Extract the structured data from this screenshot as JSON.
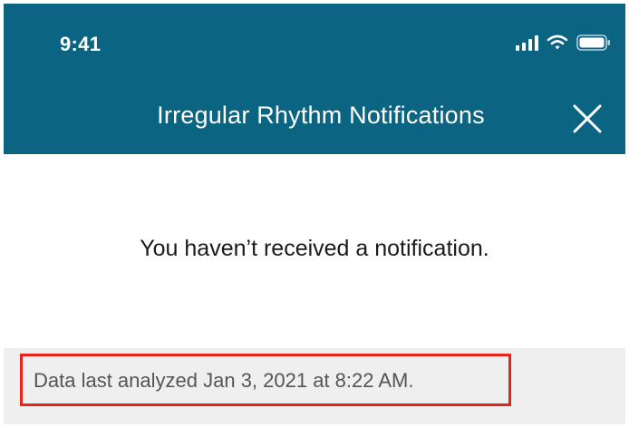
{
  "status_bar": {
    "time": "9:41"
  },
  "header": {
    "title": "Irregular Rhythm Notifications",
    "close_icon": "close-icon"
  },
  "main": {
    "message": "You haven’t received a notification."
  },
  "analysis": {
    "text": "Data last analyzed Jan 3, 2021 at 8:22 AM.",
    "highlight_color": "#e8231b"
  },
  "colors": {
    "header_bg": "#0b6482",
    "panel_bg": "#efefef"
  }
}
